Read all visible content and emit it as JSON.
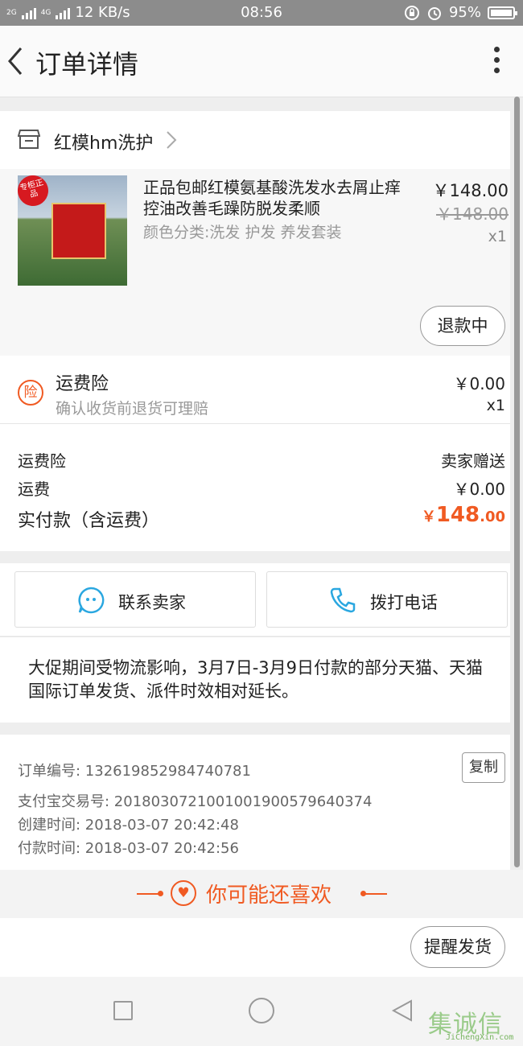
{
  "status_bar": {
    "network": "2G",
    "network2": "4G",
    "speed": "12 KB/s",
    "time": "08:56",
    "battery": "95%"
  },
  "header": {
    "title": "订单详情"
  },
  "shop": {
    "name": "红模hm洗护"
  },
  "product": {
    "badge": "专柜正品",
    "name": "正品包邮红模氨基酸洗发水去屑止痒控油改善毛躁防脱发柔顺",
    "variant": "颜色分类:洗发 护发 养发套装",
    "price": "￥148.00",
    "original_price": "￥148.00",
    "quantity": "x1",
    "status_button": "退款中"
  },
  "insurance": {
    "icon_char": "险",
    "title": "运费险",
    "subtitle": "确认收货前退货可理赔",
    "price": "￥0.00",
    "quantity": "x1"
  },
  "totals": {
    "insurance_label": "运费险",
    "insurance_value": "卖家赠送",
    "shipping_label": "运费",
    "shipping_value": "￥0.00",
    "paid_label": "实付款（含运费）",
    "paid_currency": "￥",
    "paid_integer": "148",
    "paid_decimal": ".00"
  },
  "contact": {
    "seller_label": "联系卖家",
    "phone_label": "拨打电话"
  },
  "notice": {
    "text": "大促期间受物流影响，3月7日-3月9日付款的部分天猫、天猫国际订单发货、派件时效相对延长。"
  },
  "order_info": {
    "order_no": "订单编号: 1326198529847407​81",
    "alipay_no": "支付宝交易号: 2018030721001001900579640374",
    "created": "创建时间: 2018-03-07 20:42:48",
    "paid": "付款时间: 2018-03-07 20:42:56",
    "copy_label": "复制"
  },
  "recommend": {
    "label": "你可能还喜欢"
  },
  "bottom": {
    "remind_label": "提醒发货"
  },
  "watermark": {
    "text": "集诚信",
    "url": "JiChengXin.com"
  },
  "colors": {
    "accent": "#f05a22",
    "contact_icon": "#2aa7e0"
  }
}
